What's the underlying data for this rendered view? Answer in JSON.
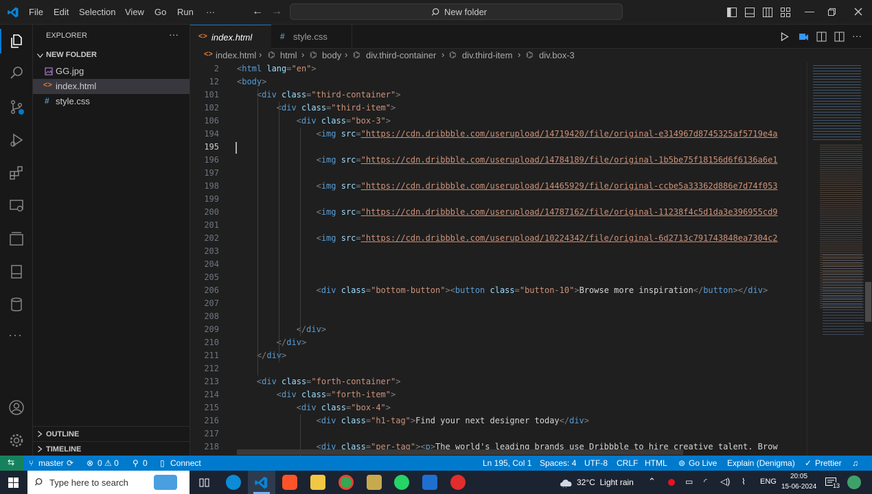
{
  "titlebar": {
    "menu": [
      "File",
      "Edit",
      "Selection",
      "View",
      "Go",
      "Run",
      "···"
    ],
    "command_center": "New folder"
  },
  "sidebar": {
    "header": "EXPLORER",
    "folder": "NEW FOLDER",
    "files": [
      {
        "name": "GG.jpg",
        "icon": "image-file-icon"
      },
      {
        "name": "index.html",
        "icon": "html-file-icon"
      },
      {
        "name": "style.css",
        "icon": "css-file-icon"
      }
    ],
    "outline": "OUTLINE",
    "timeline": "TIMELINE"
  },
  "tabs": [
    {
      "label": "index.html",
      "icon": "<>",
      "active": true
    },
    {
      "label": "style.css",
      "icon": "#",
      "active": false
    }
  ],
  "breadcrumbs": [
    "index.html",
    "html",
    "body",
    "div.third-container",
    "div.third-item",
    "div.box-3"
  ],
  "code_lines": [
    {
      "n": "2",
      "parts": [
        [
          "br",
          "<"
        ],
        [
          "tag",
          "html "
        ],
        [
          "attr",
          "lang"
        ],
        [
          "br",
          "="
        ],
        [
          "str",
          "\"en\""
        ],
        [
          "br",
          ">"
        ]
      ]
    },
    {
      "n": "12",
      "parts": [
        [
          "br",
          "<"
        ],
        [
          "tag",
          "body"
        ],
        [
          "br",
          ">"
        ]
      ]
    },
    {
      "n": "101",
      "parts": [
        [
          "txt",
          "    "
        ],
        [
          "br",
          "<"
        ],
        [
          "tag",
          "div "
        ],
        [
          "attr",
          "class"
        ],
        [
          "br",
          "="
        ],
        [
          "str",
          "\"third-container\""
        ],
        [
          "br",
          ">"
        ]
      ]
    },
    {
      "n": "102",
      "parts": [
        [
          "txt",
          "        "
        ],
        [
          "br",
          "<"
        ],
        [
          "tag",
          "div "
        ],
        [
          "attr",
          "class"
        ],
        [
          "br",
          "="
        ],
        [
          "str",
          "\"third-item\""
        ],
        [
          "br",
          ">"
        ]
      ]
    },
    {
      "n": "106",
      "parts": [
        [
          "txt",
          "            "
        ],
        [
          "br",
          "<"
        ],
        [
          "tag",
          "div "
        ],
        [
          "attr",
          "class"
        ],
        [
          "br",
          "="
        ],
        [
          "str",
          "\"box-3\""
        ],
        [
          "br",
          ">"
        ]
      ]
    },
    {
      "n": "194",
      "parts": [
        [
          "txt",
          "                "
        ],
        [
          "br",
          "<"
        ],
        [
          "tag",
          "img "
        ],
        [
          "attr",
          "src"
        ],
        [
          "br",
          "="
        ],
        [
          "url",
          "\"https://cdn.dribbble.com/userupload/14719420/file/original-e314967d8745325af5719e4a"
        ]
      ]
    },
    {
      "n": "195",
      "parts": []
    },
    {
      "n": "196",
      "parts": [
        [
          "txt",
          "                "
        ],
        [
          "br",
          "<"
        ],
        [
          "tag",
          "img "
        ],
        [
          "attr",
          "src"
        ],
        [
          "br",
          "="
        ],
        [
          "url",
          "\"https://cdn.dribbble.com/userupload/14784189/file/original-1b5be75f18156d6f6136a6e1"
        ]
      ]
    },
    {
      "n": "197",
      "parts": []
    },
    {
      "n": "198",
      "parts": [
        [
          "txt",
          "                "
        ],
        [
          "br",
          "<"
        ],
        [
          "tag",
          "img "
        ],
        [
          "attr",
          "src"
        ],
        [
          "br",
          "="
        ],
        [
          "url",
          "\"https://cdn.dribbble.com/userupload/14465929/file/original-ccbe5a33362d886e7d74f053"
        ]
      ]
    },
    {
      "n": "199",
      "parts": []
    },
    {
      "n": "200",
      "parts": [
        [
          "txt",
          "                "
        ],
        [
          "br",
          "<"
        ],
        [
          "tag",
          "img "
        ],
        [
          "attr",
          "src"
        ],
        [
          "br",
          "="
        ],
        [
          "url",
          "\"https://cdn.dribbble.com/userupload/14787162/file/original-11238f4c5d1da3e396955cd9"
        ]
      ]
    },
    {
      "n": "201",
      "parts": []
    },
    {
      "n": "202",
      "parts": [
        [
          "txt",
          "                "
        ],
        [
          "br",
          "<"
        ],
        [
          "tag",
          "img "
        ],
        [
          "attr",
          "src"
        ],
        [
          "br",
          "="
        ],
        [
          "url",
          "\"https://cdn.dribbble.com/userupload/10224342/file/original-6d2713c791743848ea7304c2"
        ]
      ]
    },
    {
      "n": "203",
      "parts": []
    },
    {
      "n": "204",
      "parts": []
    },
    {
      "n": "205",
      "parts": []
    },
    {
      "n": "206",
      "parts": [
        [
          "txt",
          "                "
        ],
        [
          "br",
          "<"
        ],
        [
          "tag",
          "div "
        ],
        [
          "attr",
          "class"
        ],
        [
          "br",
          "="
        ],
        [
          "str",
          "\"bottom-button\""
        ],
        [
          "br",
          "><"
        ],
        [
          "tag",
          "button "
        ],
        [
          "attr",
          "class"
        ],
        [
          "br",
          "="
        ],
        [
          "str",
          "\"button-10\""
        ],
        [
          "br",
          ">"
        ],
        [
          "txt",
          "Browse more inspiration"
        ],
        [
          "br",
          "</"
        ],
        [
          "tag",
          "button"
        ],
        [
          "br",
          "></"
        ],
        [
          "tag",
          "div"
        ],
        [
          "br",
          ">"
        ]
      ]
    },
    {
      "n": "207",
      "parts": []
    },
    {
      "n": "208",
      "parts": []
    },
    {
      "n": "209",
      "parts": [
        [
          "txt",
          "            "
        ],
        [
          "br",
          "</"
        ],
        [
          "tag",
          "div"
        ],
        [
          "br",
          ">"
        ]
      ]
    },
    {
      "n": "210",
      "parts": [
        [
          "txt",
          "        "
        ],
        [
          "br",
          "</"
        ],
        [
          "tag",
          "div"
        ],
        [
          "br",
          ">"
        ]
      ]
    },
    {
      "n": "211",
      "parts": [
        [
          "txt",
          "    "
        ],
        [
          "br",
          "</"
        ],
        [
          "tag",
          "div"
        ],
        [
          "br",
          ">"
        ]
      ]
    },
    {
      "n": "212",
      "parts": []
    },
    {
      "n": "213",
      "parts": [
        [
          "txt",
          "    "
        ],
        [
          "br",
          "<"
        ],
        [
          "tag",
          "div "
        ],
        [
          "attr",
          "class"
        ],
        [
          "br",
          "="
        ],
        [
          "str",
          "\"forth-container\""
        ],
        [
          "br",
          ">"
        ]
      ]
    },
    {
      "n": "214",
      "parts": [
        [
          "txt",
          "        "
        ],
        [
          "br",
          "<"
        ],
        [
          "tag",
          "div "
        ],
        [
          "attr",
          "class"
        ],
        [
          "br",
          "="
        ],
        [
          "str",
          "\"forth-item\""
        ],
        [
          "br",
          ">"
        ]
      ]
    },
    {
      "n": "215",
      "parts": [
        [
          "txt",
          "            "
        ],
        [
          "br",
          "<"
        ],
        [
          "tag",
          "div "
        ],
        [
          "attr",
          "class"
        ],
        [
          "br",
          "="
        ],
        [
          "str",
          "\"box-4\""
        ],
        [
          "br",
          ">"
        ]
      ]
    },
    {
      "n": "216",
      "parts": [
        [
          "txt",
          "                "
        ],
        [
          "br",
          "<"
        ],
        [
          "tag",
          "div "
        ],
        [
          "attr",
          "class"
        ],
        [
          "br",
          "="
        ],
        [
          "str",
          "\"h1-tag\""
        ],
        [
          "br",
          ">"
        ],
        [
          "txt",
          "Find your next designer today"
        ],
        [
          "br",
          "</"
        ],
        [
          "tag",
          "div"
        ],
        [
          "br",
          ">"
        ]
      ]
    },
    {
      "n": "217",
      "parts": []
    },
    {
      "n": "218",
      "parts": [
        [
          "txt",
          "                "
        ],
        [
          "br",
          "<"
        ],
        [
          "tag",
          "div "
        ],
        [
          "attr",
          "class"
        ],
        [
          "br",
          "="
        ],
        [
          "str",
          "\"per-tag\""
        ],
        [
          "br",
          "><"
        ],
        [
          "tag",
          "p"
        ],
        [
          "br",
          ">"
        ],
        [
          "txt",
          "The world's leading brands use Dribbble to hire creative talent. Brow"
        ]
      ]
    }
  ],
  "statusbar": {
    "branch": "master",
    "problems": "0 ⚠ 0",
    "ports": "0",
    "connect": "Connect",
    "cursor": "Ln 195, Col 1",
    "spaces": "Spaces: 4",
    "encoding": "UTF-8",
    "eol": "CRLF",
    "language": "HTML",
    "golive": "Go Live",
    "explain": "Explain (Denigma)",
    "prettier": "Prettier"
  },
  "taskbar": {
    "search_placeholder": "Type here to search",
    "weather": "32°C  Light rain",
    "lang": "ENG",
    "time": "20:05",
    "date": "15-06-2024",
    "notification_count": "13"
  },
  "colors": {
    "accent": "#007acc",
    "tag": "#569cd6",
    "attr": "#9cdcfe",
    "string": "#ce9178"
  }
}
